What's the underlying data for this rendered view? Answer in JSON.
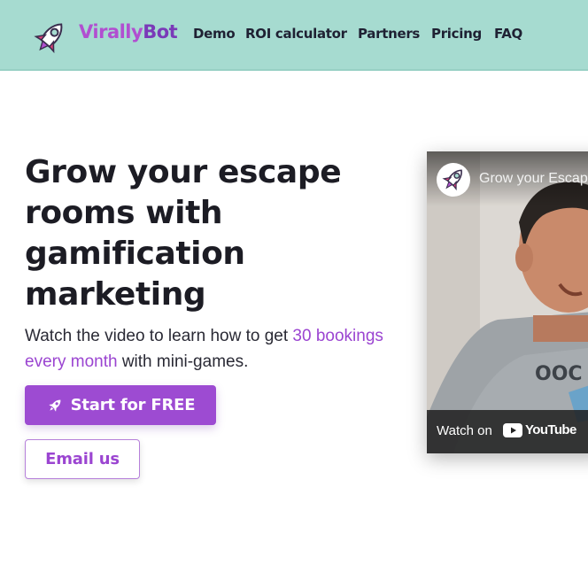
{
  "header": {
    "brand_part1": "Virally",
    "brand_part2": "Bot",
    "nav": {
      "demo": "Demo",
      "roi": "ROI calculator",
      "partners": "Partners",
      "pricing": "Pricing",
      "faq": "FAQ"
    },
    "logo_icon": "rocket-icon"
  },
  "hero": {
    "title": "Grow your escape rooms with gamification marketing",
    "subtitle_before": "Watch the video to learn how to get ",
    "subtitle_highlight": "30 bookings every month",
    "subtitle_after": " with mini-games.",
    "start_button": "Start for FREE",
    "start_button_icon": "rocket-icon",
    "email_button": "Email us"
  },
  "video": {
    "title": "Grow your Escap",
    "watch_on": "Watch on",
    "youtube_word": "YouTube",
    "play_icon": "youtube-play-icon"
  },
  "colors": {
    "header_bg": "#a6dbd0",
    "accent": "#9d4bd2",
    "text_dark": "#1c1c24"
  }
}
